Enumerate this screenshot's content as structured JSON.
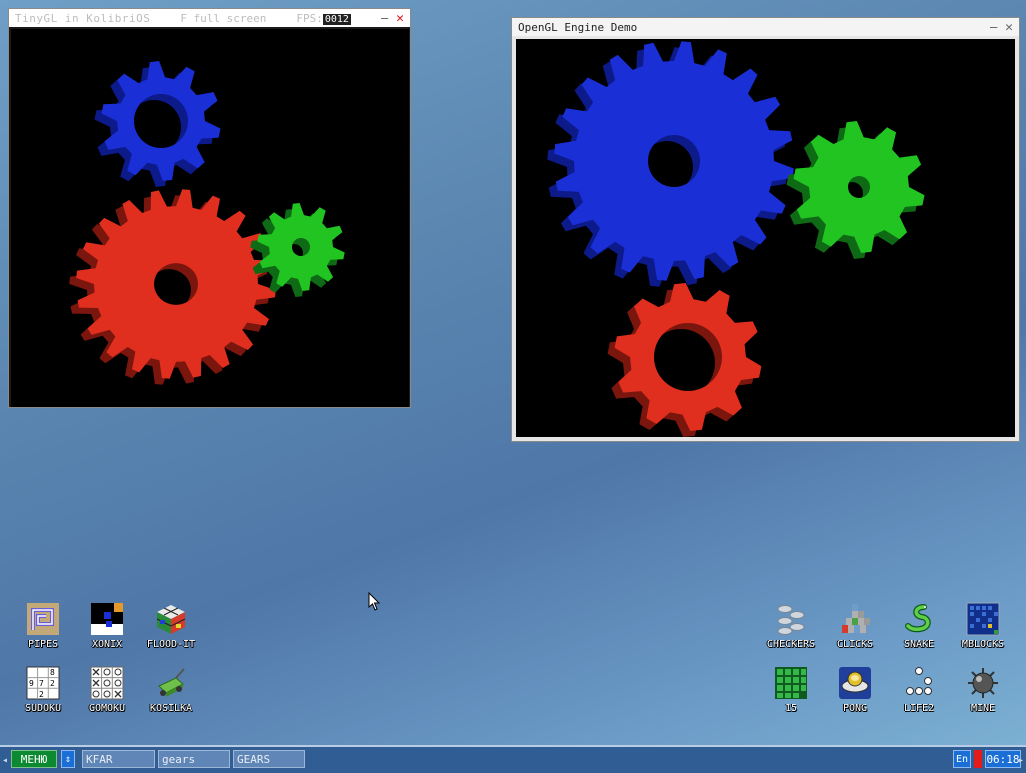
{
  "windows": {
    "tinygl": {
      "title": "TinyGL in KolibriOS",
      "hint": "F full screen",
      "fps_label": "FPS:",
      "fps_value": "0012"
    },
    "opengl": {
      "title": "OpenGL Engine Demo"
    }
  },
  "desktop_icons": {
    "left": [
      {
        "label": "PIPES",
        "icon": "pipes-icon"
      },
      {
        "label": "XONIX",
        "icon": "xonix-icon"
      },
      {
        "label": "FLOOD-IT",
        "icon": "flood-it-icon"
      },
      {
        "label": "SUDOKU",
        "icon": "sudoku-icon"
      },
      {
        "label": "GOMOKU",
        "icon": "gomoku-icon"
      },
      {
        "label": "KOSILKA",
        "icon": "kosilka-icon"
      }
    ],
    "right": [
      {
        "label": "CHECKERS",
        "icon": "checkers-icon"
      },
      {
        "label": "CLICKS",
        "icon": "clicks-icon"
      },
      {
        "label": "SNAKE",
        "icon": "snake-icon"
      },
      {
        "label": "MBLOCKS",
        "icon": "mblocks-icon"
      },
      {
        "label": "15",
        "icon": "fifteen-icon"
      },
      {
        "label": "PONG",
        "icon": "pong-icon"
      },
      {
        "label": "LIFE2",
        "icon": "life2-icon"
      },
      {
        "label": "MINE",
        "icon": "mine-icon"
      }
    ]
  },
  "taskbar": {
    "menu_label": "МЕНЮ",
    "tasks": [
      "KFAR",
      "gears",
      "GEARS"
    ],
    "language": "En",
    "time": "06:18"
  },
  "colors": {
    "gear_blue": "#1b2fd6",
    "gear_red": "#e02f1f",
    "gear_green": "#22c422",
    "taskbar": "#2f5d94",
    "menu_green": "#0c8a32"
  }
}
